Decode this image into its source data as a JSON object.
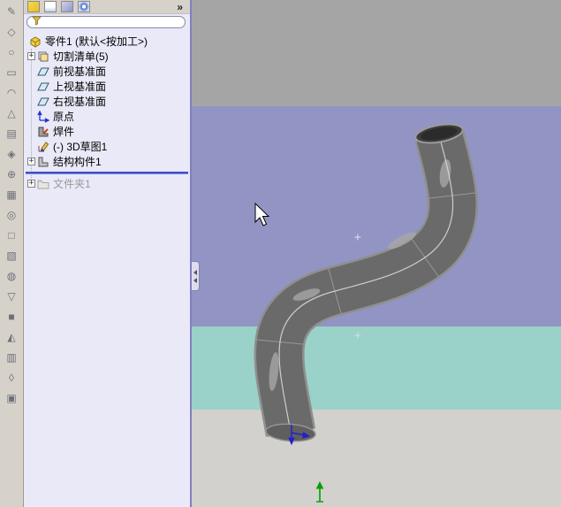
{
  "app": {
    "name": "SolidWorks part window"
  },
  "left_toolbar": {
    "icons": [
      "✎",
      "◇",
      "○",
      "▭",
      "◠",
      "△",
      "▤",
      "◈",
      "⊕",
      "▦",
      "◎",
      "□",
      "▧",
      "◍",
      "▽",
      "■",
      "◭",
      "▥",
      "◊",
      "▣"
    ]
  },
  "feature_tree": {
    "chevron": "»",
    "filter_value": "",
    "tabs": [
      {
        "name": "featuremanager-tab"
      },
      {
        "name": "propertymanager-tab"
      },
      {
        "name": "configurationmanager-tab"
      },
      {
        "name": "dimxpert-tab"
      }
    ],
    "items": [
      {
        "label": "零件1 (默认<按加工>)",
        "expand": "",
        "icon": "part-icon"
      },
      {
        "label": "切割清单(5)",
        "expand": "+",
        "icon": "cutlist-icon"
      },
      {
        "label": "前视基准面",
        "expand": "",
        "icon": "plane-icon"
      },
      {
        "label": "上视基准面",
        "expand": "",
        "icon": "plane-icon"
      },
      {
        "label": "右视基准面",
        "expand": "",
        "icon": "plane-icon"
      },
      {
        "label": "原点",
        "expand": "",
        "icon": "origin-icon"
      },
      {
        "label": "焊件",
        "expand": "",
        "icon": "weldment-icon"
      },
      {
        "label": "(-) 3D草图1",
        "expand": "",
        "icon": "sketch3d-icon"
      },
      {
        "label": "结构构件1",
        "expand": "+",
        "icon": "structural-member-icon"
      },
      {
        "label": "文件夹1",
        "expand": "+",
        "icon": "folder-icon",
        "disabled": true
      }
    ]
  },
  "viewport": {
    "markers": {
      "plus": "+"
    },
    "colors": {
      "band_top": "#A6A5A6",
      "band_purple": "#9295C3",
      "band_teal": "#9AD1C8",
      "band_bottom": "#D2D1CD",
      "pipe_body": "#6A6A6A",
      "pipe_rim": "#8F8F8F",
      "sketch_line": "#D8D8D8",
      "origin_blue": "#2020CC",
      "axis_green": "#00A000"
    }
  }
}
